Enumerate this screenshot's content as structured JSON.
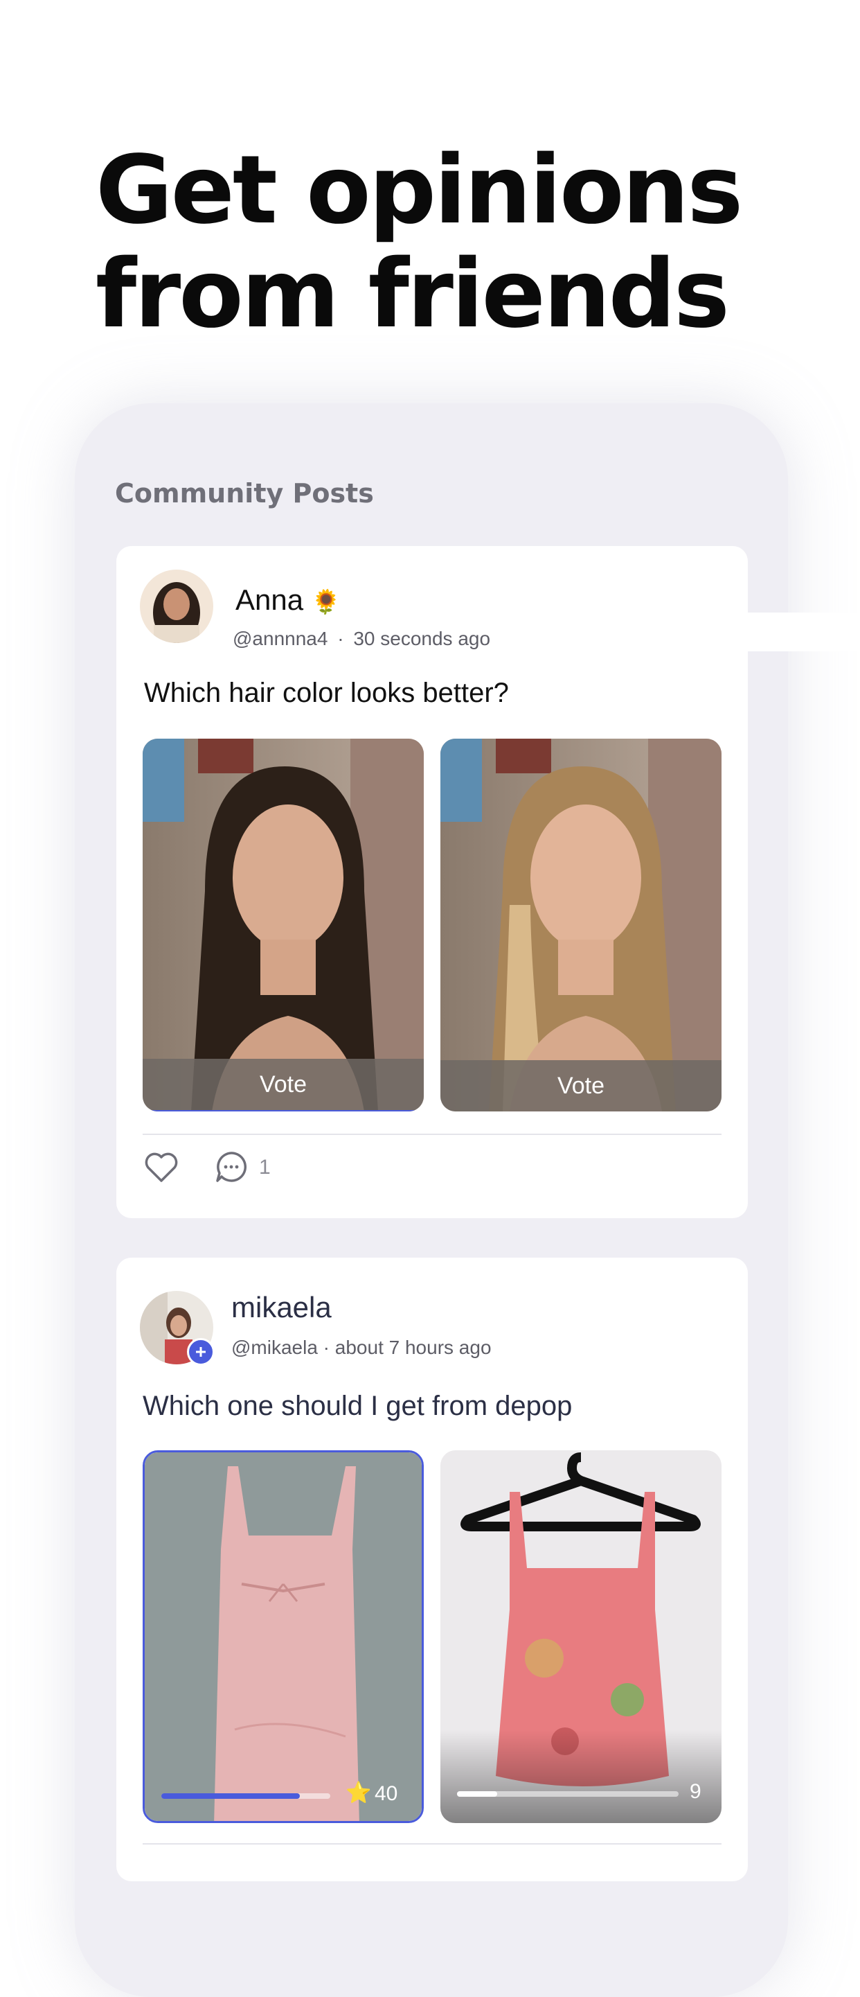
{
  "headline": {
    "line1": "Get opinions",
    "line2": "from friends"
  },
  "section_title": "Community Posts",
  "posts": [
    {
      "name": "Anna",
      "name_emoji": "🌻",
      "handle": "@annnna4",
      "separator": "·",
      "time": "30 seconds ago",
      "question": "Which hair color looks better?",
      "options": [
        {
          "label": "Vote"
        },
        {
          "label": "Vote"
        }
      ],
      "comment_count": "1"
    },
    {
      "name": "mikaela",
      "meta": "@mikaela · about 7 hours ago",
      "question": "Which one should I get from depop",
      "options": [
        {
          "progress": 0.82,
          "votes": "40",
          "color": "#4a5bdc",
          "star": "⭐"
        },
        {
          "progress": 0.18,
          "votes": "9",
          "color": "#ffffff"
        }
      ]
    }
  ],
  "colors": {
    "accent": "#4a5bdc",
    "background": "#efeef4"
  }
}
